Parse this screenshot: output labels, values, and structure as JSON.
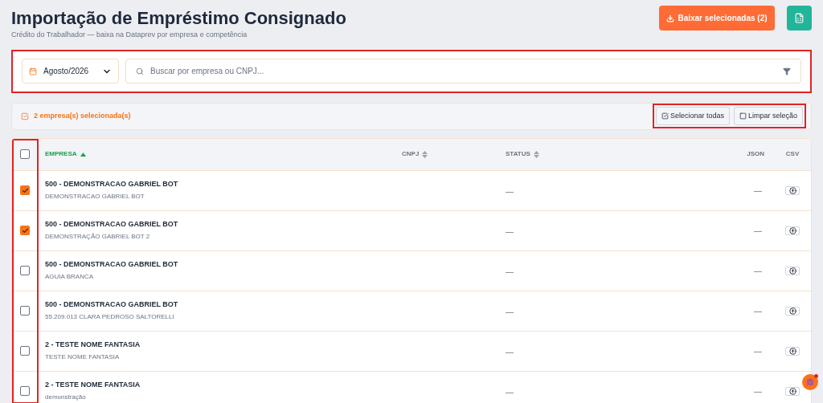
{
  "header": {
    "title": "Importação de Empréstimo Consignado",
    "subtitle": "Crédito do Trabalhador — baixa na Dataprev por empresa e competência",
    "download_button": "Baixar selecionadas (2)"
  },
  "filters": {
    "month": "Agosto/2026",
    "search_placeholder": "Buscar por empresa ou CNPJ...",
    "highlighted": true
  },
  "selection_bar": {
    "count_text": "2 empresa(s) selecionada(s)",
    "select_all": "Selecionar todas",
    "clear": "Limpar seleção",
    "highlighted": true
  },
  "table": {
    "select_all_checked": false,
    "checkbox_column_highlighted": true,
    "columns": [
      {
        "label": "EMPRESA",
        "sortable": true,
        "sorted": true
      },
      {
        "label": "CNPJ",
        "sortable": true,
        "sorted": false
      },
      {
        "label": "STATUS",
        "sortable": true,
        "sorted": false
      },
      {
        "label": "JSON",
        "sortable": false,
        "sorted": false
      },
      {
        "label": "CSV",
        "sortable": false,
        "sorted": false
      }
    ],
    "rows": [
      {
        "checked": true,
        "name": "500 - DEMONSTRACAO GABRIEL BOT",
        "trade_name": "DEMONSTRACAO GABRIEL BOT",
        "status": "—",
        "json": "—"
      },
      {
        "checked": true,
        "name": "500 - DEMONSTRACAO GABRIEL BOT",
        "trade_name": "DEMONSTRAÇÃO GABRIEL BOT 2",
        "status": "—",
        "json": "—"
      },
      {
        "checked": false,
        "name": "500 - DEMONSTRACAO GABRIEL BOT",
        "trade_name": "AGUIA BRANCA",
        "status": "—",
        "json": "—"
      },
      {
        "checked": false,
        "name": "500 - DEMONSTRACAO GABRIEL BOT",
        "trade_name": "55.209.013 CLARA PEDROSO SALTORELLI",
        "status": "—",
        "json": "—"
      },
      {
        "checked": false,
        "name": "2 - TESTE NOME FANTASIA",
        "trade_name": "TESTE NOME FANTASIA",
        "status": "—",
        "json": "—"
      },
      {
        "checked": false,
        "name": "2 - TESTE NOME FANTASIA",
        "trade_name": "demonstração",
        "status": "—",
        "json": "—"
      }
    ]
  },
  "chat_bubble": {
    "unread": true
  }
}
